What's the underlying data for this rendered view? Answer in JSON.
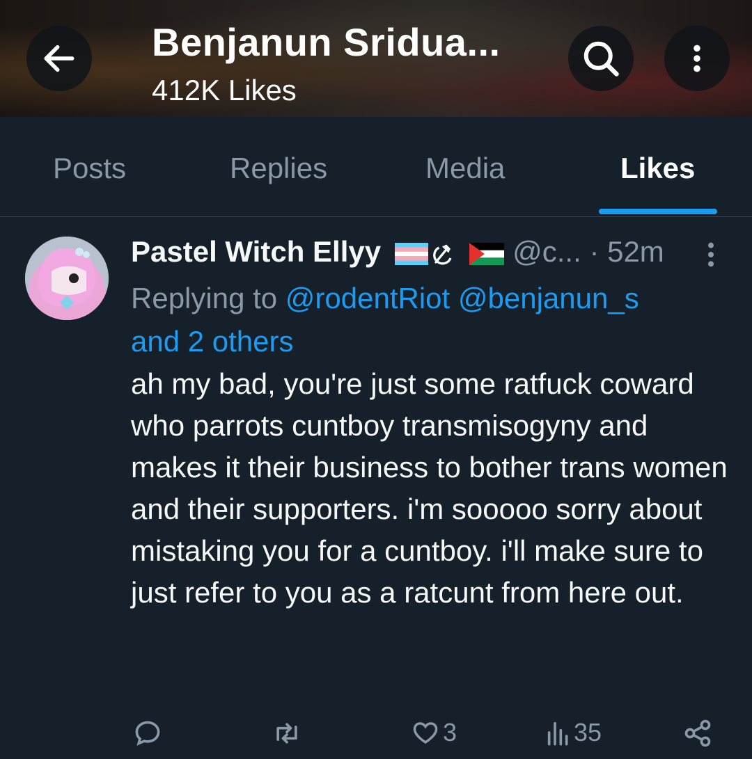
{
  "header": {
    "title": "Benjanun Sridua...",
    "subtitle": "412K Likes"
  },
  "tabs": [
    {
      "label": "Posts",
      "active": false
    },
    {
      "label": "Replies",
      "active": false
    },
    {
      "label": "Media",
      "active": false
    },
    {
      "label": "Likes",
      "active": true
    }
  ],
  "tweet": {
    "display_name": "Pastel Witch Ellyy",
    "handle": "@c...",
    "time": "· 52m",
    "replying_prefix": "Replying to",
    "replying_users": [
      "@rodentRiot",
      "@benjanun_s"
    ],
    "replying_others": "and 2 others",
    "body": "ah my bad, you're just some ratfuck coward who parrots cuntboy transmisogyny and makes it their business to bother trans women and their supporters. i'm sooooo sorry about mistaking you for a cuntboy. i'll make sure to just refer to you as a ratcunt from here out.",
    "likes_count": "3",
    "views_count": "35"
  },
  "colors": {
    "background": "#15202b",
    "accent": "#1d9bf0",
    "muted": "#8b98a5"
  },
  "icons": [
    "back-arrow-icon",
    "search-icon",
    "more-vertical-icon",
    "reply-icon",
    "retweet-icon",
    "heart-icon",
    "views-icon",
    "share-icon"
  ]
}
